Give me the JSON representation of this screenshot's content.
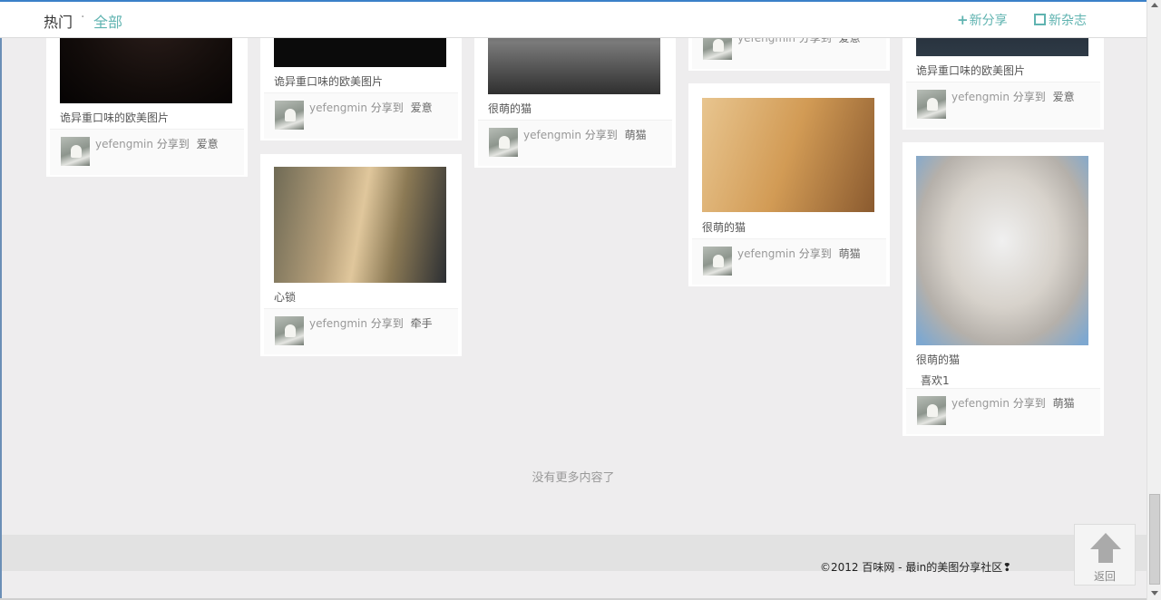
{
  "nav": {
    "hot": "热门",
    "separator": "·",
    "all": "全部",
    "new_share": "新分享",
    "new_magazine": "新杂志"
  },
  "cards": [
    {
      "title": "诡异重口味的欧美图片",
      "user": "yefengmin",
      "action": "分享到",
      "board": "爱意"
    },
    {
      "title": "诡异重口味的欧美图片",
      "user": "yefengmin",
      "action": "分享到",
      "board": "爱意"
    },
    {
      "title": "心锁",
      "user": "yefengmin",
      "action": "分享到",
      "board": "牵手"
    },
    {
      "title": "很萌的猫",
      "user": "yefengmin",
      "action": "分享到",
      "board": "萌猫"
    },
    {
      "title": "很萌的猫",
      "user": "yefengmin",
      "action": "分享到",
      "board": "萌猫"
    },
    {
      "title": "诡异重口味的欧美图片",
      "user": "yefengmin",
      "action": "分享到",
      "board": "爱意"
    },
    {
      "title": "很萌的猫",
      "like": "喜欢1",
      "user": "yefengmin",
      "action": "分享到",
      "board": "萌猫"
    }
  ],
  "partial_card": {
    "user": "yefengmin",
    "action": "分享到",
    "board": "爱意"
  },
  "no_more": "没有更多内容了",
  "copyright": "©2012 百味网 - 最in的美图分享社区❢",
  "back_to_top": "返回",
  "colors": {
    "accent": "#5fb3b0",
    "page_bg": "#eeedee"
  }
}
